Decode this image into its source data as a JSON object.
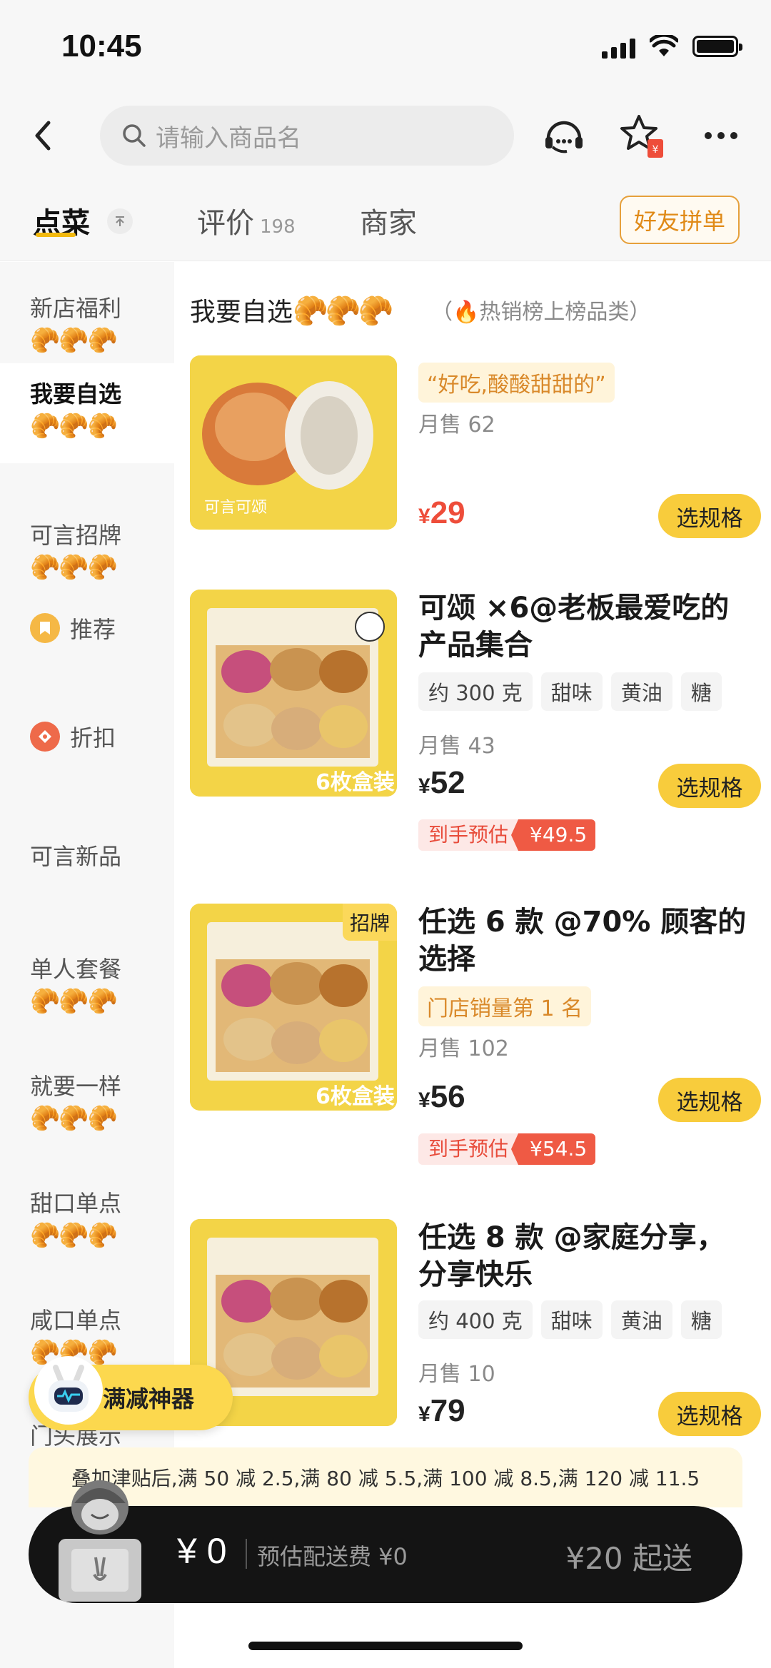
{
  "status_bar": {
    "time": "10:45"
  },
  "search": {
    "placeholder": "请输入商品名"
  },
  "tabs": [
    {
      "label": "点菜"
    },
    {
      "label": "评价",
      "count": "198"
    },
    {
      "label": "商家"
    }
  ],
  "friends_button": "好友拼单",
  "sidebar": {
    "items": [
      {
        "label": "新店福利",
        "emoji": "🥐🥐🥐"
      },
      {
        "label": "我要自选",
        "emoji": "🥐🥐🥐"
      },
      {
        "label": "可言招牌",
        "emoji": "🥐🥐🥐"
      },
      {
        "label": "推荐"
      },
      {
        "label": "折扣"
      },
      {
        "label": "可言新品"
      },
      {
        "label": "单人套餐",
        "emoji": "🥐🥐🥐"
      },
      {
        "label": "就要一样",
        "emoji": "🥐🥐🥐"
      },
      {
        "label": "甜口单点",
        "emoji": "🥐🥐🥐"
      },
      {
        "label": "咸口单点",
        "emoji": "🥐🥐🥐"
      },
      {
        "label": "门头展示"
      }
    ]
  },
  "section": {
    "title": "我要自选",
    "emoji": "🥐🥐🥐",
    "note": "（🔥热销榜上榜品类）"
  },
  "products": [
    {
      "quote": "“好吃,酸酸甜甜的”",
      "sales": "月售 62",
      "currency": "¥",
      "price": "29",
      "button": "选规格",
      "image_text": "可言可颂"
    },
    {
      "name": "可颂 ×6@老板最爱吃的产品集合",
      "tags": [
        "约 300 克",
        "甜味",
        "黄油",
        "糖"
      ],
      "sales": "月售 43",
      "currency": "¥",
      "price": "52",
      "button": "选规格",
      "estimate_label": "到手预估",
      "estimate_value": "¥49.5",
      "image_text": "6枚盒装"
    },
    {
      "name": "任选 6 款 @70% 顾客的选择",
      "badge": "门店销量第 1 名",
      "corner_badge": "招牌",
      "sales": "月售 102",
      "currency": "¥",
      "price": "56",
      "button": "选规格",
      "estimate_label": "到手预估",
      "estimate_value": "¥54.5",
      "image_text": "6枚盒装"
    },
    {
      "name": "任选 8 款 @家庭分享，分享快乐",
      "tags": [
        "约 400 克",
        "甜味",
        "黄油",
        "糖"
      ],
      "sales": "月售 10",
      "currency": "¥",
      "price": "79",
      "button": "选规格"
    }
  ],
  "promo_float": "满减神器",
  "subsidy": "叠加津贴后,满 50 减 2.5,满 80 减 5.5,满 100 减 8.5,满 120 减 11.5",
  "cart": {
    "total": "¥ 0",
    "delivery": "预估配送费 ¥0",
    "min_order": "¥20 起送"
  },
  "colors": {
    "accent": "#f8cc3c",
    "price_red": "#ee4d3a",
    "orange": "#e08a17"
  }
}
